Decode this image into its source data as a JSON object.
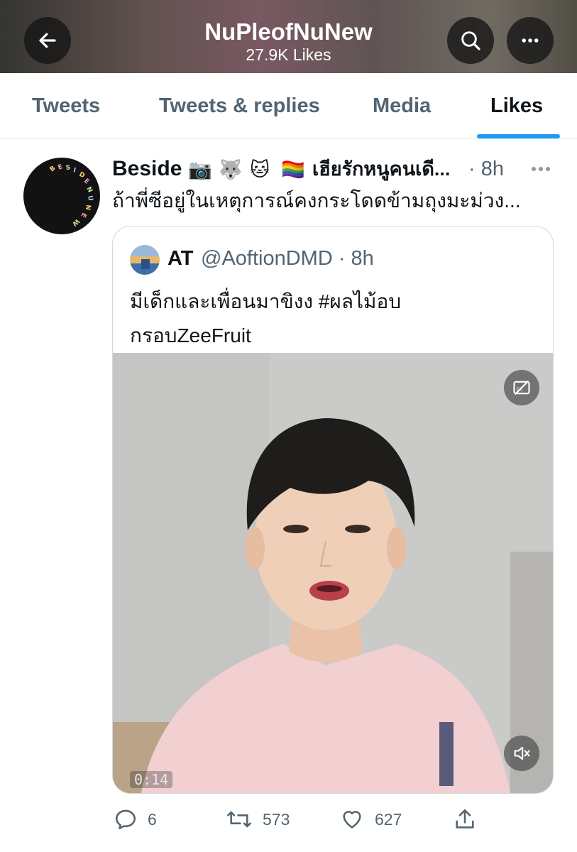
{
  "header": {
    "title": "NuPleofNuNew",
    "subtitle": "27.9K Likes",
    "back_icon": "arrow-left-icon",
    "search_icon": "search-icon",
    "more_icon": "more-horizontal-icon"
  },
  "tabs": [
    {
      "label": "Tweets",
      "active": false
    },
    {
      "label": "Tweets & replies",
      "active": false
    },
    {
      "label": "Media",
      "active": false
    },
    {
      "label": "Likes",
      "active": true
    }
  ],
  "tweet": {
    "author_name": "Beside",
    "author_name_suffix": "เฮียรักหนูคนเดี...",
    "author_emojis": [
      "📷",
      "🐺",
      "🐱",
      "🏳️‍🌈"
    ],
    "time": "· 8h",
    "text": "ถ้าพี่ซีอยู่ในเหตุการณ์คงกระโดดข้ามถุงมะม่วง...",
    "avatar_ring_text": "BESIDENUNEW",
    "quoted": {
      "name": "AT",
      "handle_time": "@AoftionDMD · 8h",
      "text_line1": "มีเด็กและเพื่อนมาขิงง #ผลไม้อบ",
      "text_line2": "กรอบZeeFruit",
      "video_duration": "0:14",
      "cc_icon": "captions-off-icon",
      "mute_icon": "volume-muted-icon"
    },
    "actions": {
      "replies": "6",
      "retweets": "573",
      "likes": "627",
      "share_icon": "share-icon"
    }
  },
  "colors": {
    "accent": "#1d9bf0",
    "text_primary": "#0f1419",
    "text_secondary": "#536471",
    "border": "#cfd9de"
  }
}
